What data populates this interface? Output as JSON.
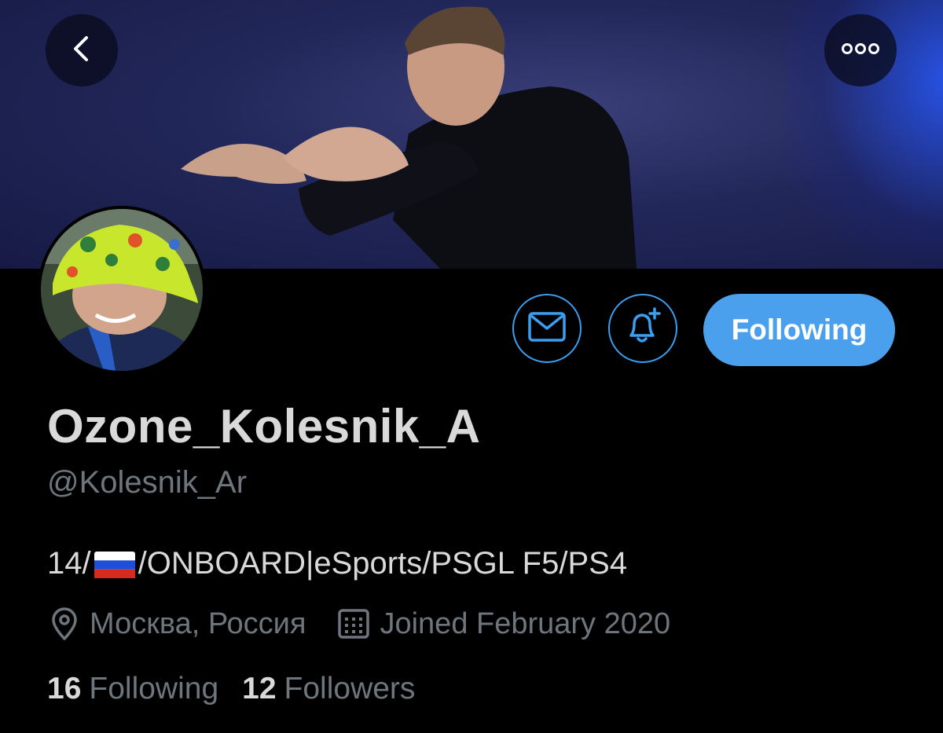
{
  "profile": {
    "display_name": "Ozone_Kolesnik_A",
    "handle": "@Kolesnik_Ar",
    "bio_prefix": "14/",
    "bio_suffix": "/ONBOARD|eSports/PSGL F5/PS4",
    "location": "Москва, Россия",
    "joined": "Joined February 2020"
  },
  "stats": {
    "following_count": "16",
    "following_label": "Following",
    "followers_count": "12",
    "followers_label": "Followers"
  },
  "actions": {
    "follow_label": "Following"
  },
  "icons": {
    "back": "chevron-left-icon",
    "more": "more-horizontal-icon",
    "message": "envelope-icon",
    "notifications": "bell-plus-icon",
    "location": "map-pin-icon",
    "calendar": "calendar-icon",
    "flag": "russia-flag-icon"
  },
  "colors": {
    "accent": "#4aa0ec",
    "background": "#000000",
    "muted_text": "#6e767d",
    "primary_text": "#d9d9d9"
  }
}
